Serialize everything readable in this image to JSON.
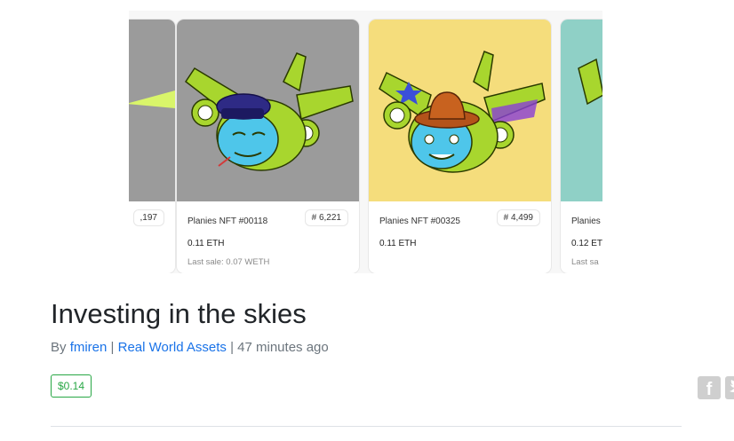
{
  "gallery": {
    "cards": [
      {
        "name": "",
        "rank": ",197",
        "price": "",
        "last_sale": ""
      },
      {
        "name": "Planies NFT #00118",
        "rank": "# 6,221",
        "price": "0.11 ETH",
        "last_sale": "Last sale: 0.07 WETH"
      },
      {
        "name": "Planies NFT #00325",
        "rank": "# 4,499",
        "price": "0.11 ETH",
        "last_sale": ""
      },
      {
        "name": "Planies",
        "rank": "",
        "price": "0.12 ET",
        "last_sale": "Last sa"
      }
    ],
    "colors": {
      "card_bg_1": "#9b9b9b",
      "card_bg_2": "#f5dd7c",
      "card_bg_3": "#8fd0c6"
    }
  },
  "article": {
    "title": "Investing in the skies",
    "by_label": "By",
    "author": "fmiren",
    "separator": "|",
    "category": "Real World Assets",
    "time": "47 minutes ago",
    "payout": "$0.14"
  },
  "share": {
    "icons": [
      "facebook-icon",
      "twitter-icon"
    ]
  }
}
